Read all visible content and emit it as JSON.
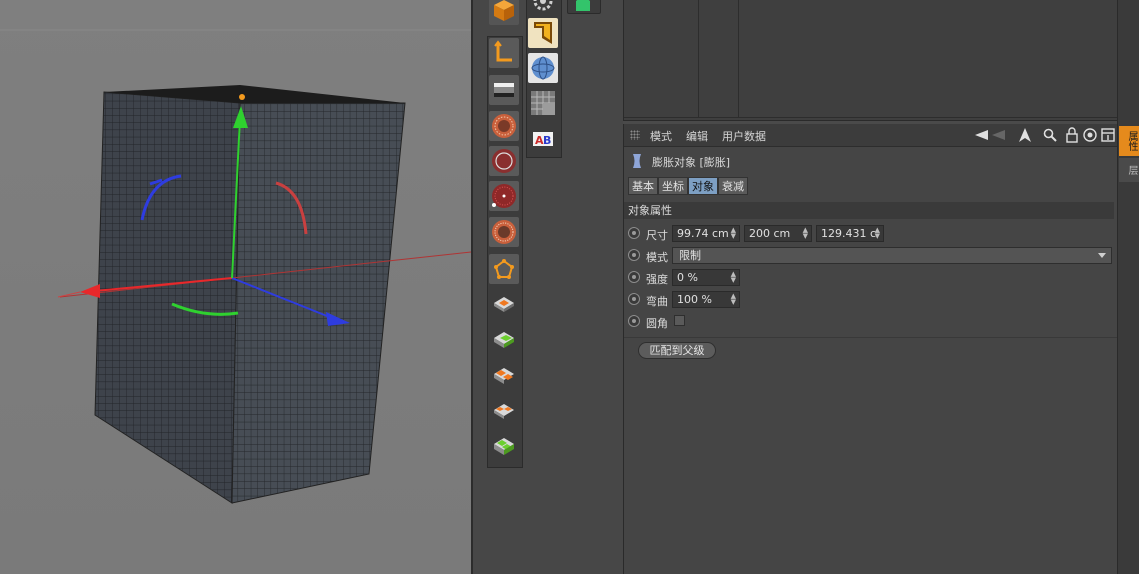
{
  "attribute_manager": {
    "menu": [
      "模式",
      "编辑",
      "用户数据"
    ],
    "object_title": "膨胀对象 [膨胀]",
    "tabs": [
      {
        "label": "基本",
        "active": false
      },
      {
        "label": "坐标",
        "active": false
      },
      {
        "label": "对象",
        "active": true
      },
      {
        "label": "衰减",
        "active": false
      }
    ],
    "section_title": "对象属性",
    "props": {
      "size_label": "尺寸",
      "size_x": "99.74 cm",
      "size_y": "200 cm",
      "size_z": "129.431 c",
      "mode_label": "模式",
      "mode_value": "限制",
      "strength_label": "强度",
      "strength_value": "0 %",
      "curvature_label": "弯曲",
      "curvature_value": "100 %",
      "round_label": "圆角",
      "round_checked": false
    },
    "match_parent_label": "匹配到父级"
  },
  "side_tabs": [
    "属性",
    "层"
  ],
  "colors": {
    "active_tab": "#7d9fc3",
    "axis_x": "#e8282b",
    "axis_y": "#2fd12f",
    "axis_z": "#2e3ce0",
    "accent_orange": "#f39a1e"
  }
}
